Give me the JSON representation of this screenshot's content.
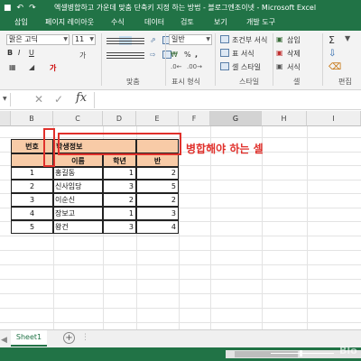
{
  "window": {
    "title": "엑셀병합하고 가운데 맞춤 단축키 지정 하는 방법 - 블로그엔조이넷 - Microsoft Excel"
  },
  "ribbon_tabs": [
    "삽입",
    "페이지 레이아웃",
    "수식",
    "데이터",
    "검토",
    "보기",
    "개발 도구"
  ],
  "ribbon": {
    "font_name": "맑은 고딕",
    "font_size": "11",
    "number_format": "일반",
    "groups": {
      "alignment": "맞춤",
      "number": "표시 형식",
      "styles": "스타일",
      "cells": "셀",
      "editing": "편집"
    },
    "styles": {
      "conditional": "조건부 서식",
      "table": "표 서식",
      "cell": "셀 스타일"
    },
    "cells": {
      "insert": "삽입",
      "delete": "삭제",
      "format": "서식"
    }
  },
  "formula_bar": {
    "fx": "fx",
    "content": ""
  },
  "columns": [
    "B",
    "C",
    "D",
    "E",
    "F",
    "G",
    "H",
    "I"
  ],
  "selected_column": "G",
  "table": {
    "header_row1": {
      "b": "번호",
      "c": "학생정보"
    },
    "header_row2": {
      "c": "이름",
      "d": "학년",
      "e": "반"
    },
    "rows": [
      {
        "no": "1",
        "name": "홍길동",
        "grade": "1",
        "class": "2"
      },
      {
        "no": "2",
        "name": "신사임당",
        "grade": "3",
        "class": "5"
      },
      {
        "no": "3",
        "name": "이순신",
        "grade": "2",
        "class": "2"
      },
      {
        "no": "4",
        "name": "장보고",
        "grade": "1",
        "class": "3"
      },
      {
        "no": "5",
        "name": "왕건",
        "grade": "3",
        "class": "4"
      }
    ]
  },
  "annotation": "병합해야 하는 셀",
  "colors": {
    "excel_green": "#217346",
    "header_fill": "#f8cba7",
    "annotation_red": "#e0302b"
  },
  "sheet_tab": "Sheet1",
  "watermark": "Blo"
}
